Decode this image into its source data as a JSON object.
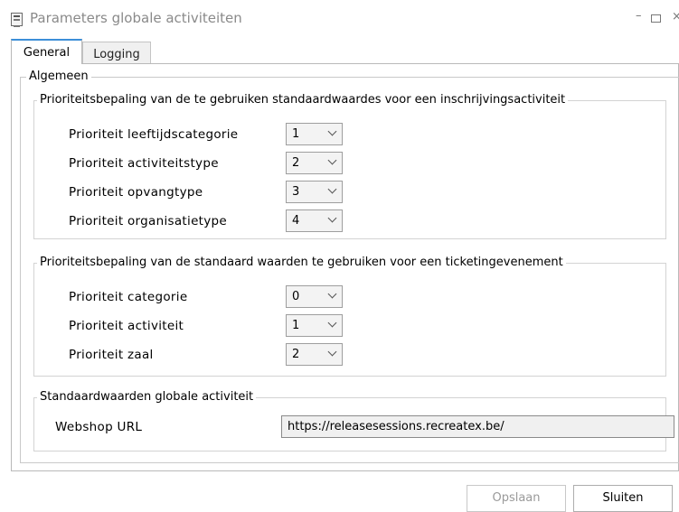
{
  "window": {
    "title": "Parameters globale activiteiten",
    "icon": "app-window-icon",
    "controls": {
      "minimize": "–",
      "maximize": "□",
      "close": "×"
    }
  },
  "tabs": [
    {
      "label": "General",
      "active": true
    },
    {
      "label": "Logging",
      "active": false
    }
  ],
  "general": {
    "group_title": "Algemeen",
    "inschrijving": {
      "title": "Prioriteitsbepaling van de te gebruiken standaardwaardes voor een inschrijvingsactiviteit",
      "rows": [
        {
          "label": "Prioriteit leeftijdscategorie",
          "value": "1"
        },
        {
          "label": "Prioriteit activiteitstype",
          "value": "2"
        },
        {
          "label": "Prioriteit opvangtype",
          "value": "3"
        },
        {
          "label": "Prioriteit organisatietype",
          "value": "4"
        }
      ]
    },
    "ticketing": {
      "title": "Prioriteitsbepaling van de standaard waarden te gebruiken voor een ticketingevenement",
      "rows": [
        {
          "label": "Prioriteit categorie",
          "value": "0"
        },
        {
          "label": "Prioriteit activiteit",
          "value": "1"
        },
        {
          "label": "Prioriteit zaal",
          "value": "2"
        }
      ]
    },
    "standaard": {
      "title": "Standaardwaarden globale activiteit",
      "webshop_label": "Webshop URL",
      "webshop_value": "https://releasesessions.recreatex.be/"
    }
  },
  "buttons": {
    "save": "Opslaan",
    "close": "Sluiten"
  }
}
